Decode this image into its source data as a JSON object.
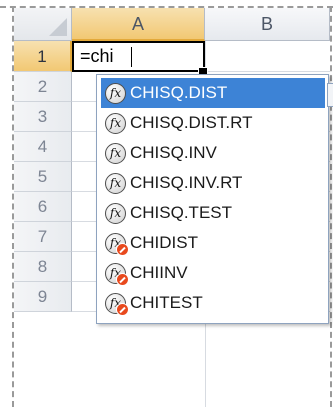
{
  "columns": [
    "A",
    "B"
  ],
  "rows": [
    "1",
    "2",
    "3",
    "4",
    "5",
    "6",
    "7",
    "8",
    "9"
  ],
  "active_cell": {
    "value": "=chi"
  },
  "autocomplete": {
    "icon_text": "fx",
    "items": [
      {
        "label": "CHISQ.DIST",
        "icon": "function-icon",
        "selected": true
      },
      {
        "label": "CHISQ.DIST.RT",
        "icon": "function-icon"
      },
      {
        "label": "CHISQ.INV",
        "icon": "function-icon"
      },
      {
        "label": "CHISQ.INV.RT",
        "icon": "function-icon"
      },
      {
        "label": "CHISQ.TEST",
        "icon": "function-icon"
      },
      {
        "label": "CHIDIST",
        "icon": "legacy-function-icon"
      },
      {
        "label": "CHIINV",
        "icon": "legacy-function-icon"
      },
      {
        "label": "CHITEST",
        "icon": "legacy-function-icon"
      }
    ]
  },
  "colors": {
    "selection_highlight": "#3d83d6",
    "active_header": "#f2c873",
    "legacy_badge": "#e8491d"
  }
}
